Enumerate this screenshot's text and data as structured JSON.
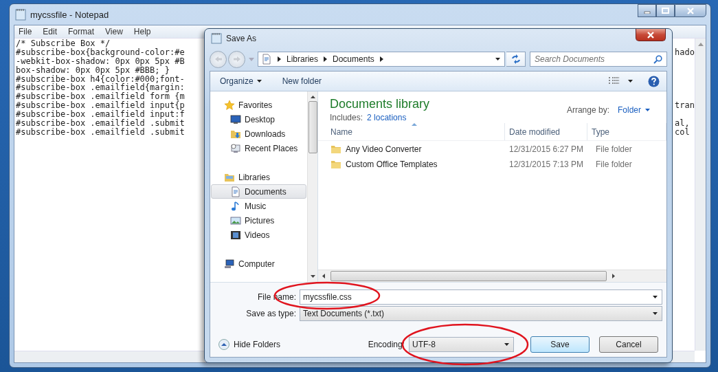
{
  "notepad": {
    "title": "mycssfile - Notepad",
    "menu": [
      "File",
      "Edit",
      "Format",
      "View",
      "Help"
    ],
    "lines": [
      {
        "left": "/* Subscribe Box */"
      },
      {
        "left": "#subscribe-box{background-color:#e",
        "right": "hado"
      },
      {
        "left": "-webkit-box-shadow: 0px 0px 5px #B"
      },
      {
        "left": "box-shadow: 0px 0px 5px #BBB; }"
      },
      {
        "left": "#subscribe-box h4{color:#000;font-"
      },
      {
        "left": "#subscribe-box .emailfield{margin:"
      },
      {
        "left": "#subscribe-box .emailfield form {m"
      },
      {
        "left": "#subscribe-box .emailfield input{p",
        "right": "tran"
      },
      {
        "left": "#subscribe-box .emailfield input:f"
      },
      {
        "left": "#subscribe-box .emailfield .submit",
        "right": "al,"
      },
      {
        "left": "#subscribe-box .emailfield .submit",
        "right": "col"
      }
    ]
  },
  "dialog": {
    "title": "Save As",
    "breadcrumb": [
      "Libraries",
      "Documents"
    ],
    "search": {
      "placeholder": "Search Documents"
    },
    "toolbar": {
      "organize": "Organize",
      "new_folder": "New folder"
    },
    "nav": [
      {
        "label": "Favorites",
        "selected": false,
        "children": [
          {
            "label": "Desktop",
            "selected": false
          },
          {
            "label": "Downloads",
            "selected": false
          },
          {
            "label": "Recent Places",
            "selected": false
          }
        ]
      },
      {
        "label": "Libraries",
        "selected": false,
        "children": [
          {
            "label": "Documents",
            "selected": true
          },
          {
            "label": "Music",
            "selected": false
          },
          {
            "label": "Pictures",
            "selected": false
          },
          {
            "label": "Videos",
            "selected": false
          }
        ]
      },
      {
        "label": "Computer",
        "selected": false
      }
    ],
    "library": {
      "title": "Documents library",
      "includes_label": "Includes:",
      "includes_link": "2 locations",
      "arrange_label": "Arrange by:",
      "arrange_value": "Folder"
    },
    "columns": [
      {
        "label": "Name",
        "sorted": true
      },
      {
        "label": "Date modified",
        "sorted": false
      },
      {
        "label": "Type",
        "sorted": false
      }
    ],
    "files": [
      {
        "name": "Any Video Converter",
        "date": "12/31/2015 6:27 PM",
        "type": "File folder"
      },
      {
        "name": "Custom Office Templates",
        "date": "12/31/2015 7:13 PM",
        "type": "File folder"
      }
    ],
    "file_name": {
      "label": "File name:",
      "value": "mycssfile.css"
    },
    "save_as_type": {
      "label": "Save as type:",
      "value": "Text Documents (*.txt)"
    },
    "hide_folders": "Hide Folders",
    "encoding": {
      "label": "Encoding:",
      "value": "UTF-8"
    },
    "buttons": [
      {
        "label": "Save",
        "default": true
      },
      {
        "label": "Cancel",
        "default": false
      }
    ]
  }
}
